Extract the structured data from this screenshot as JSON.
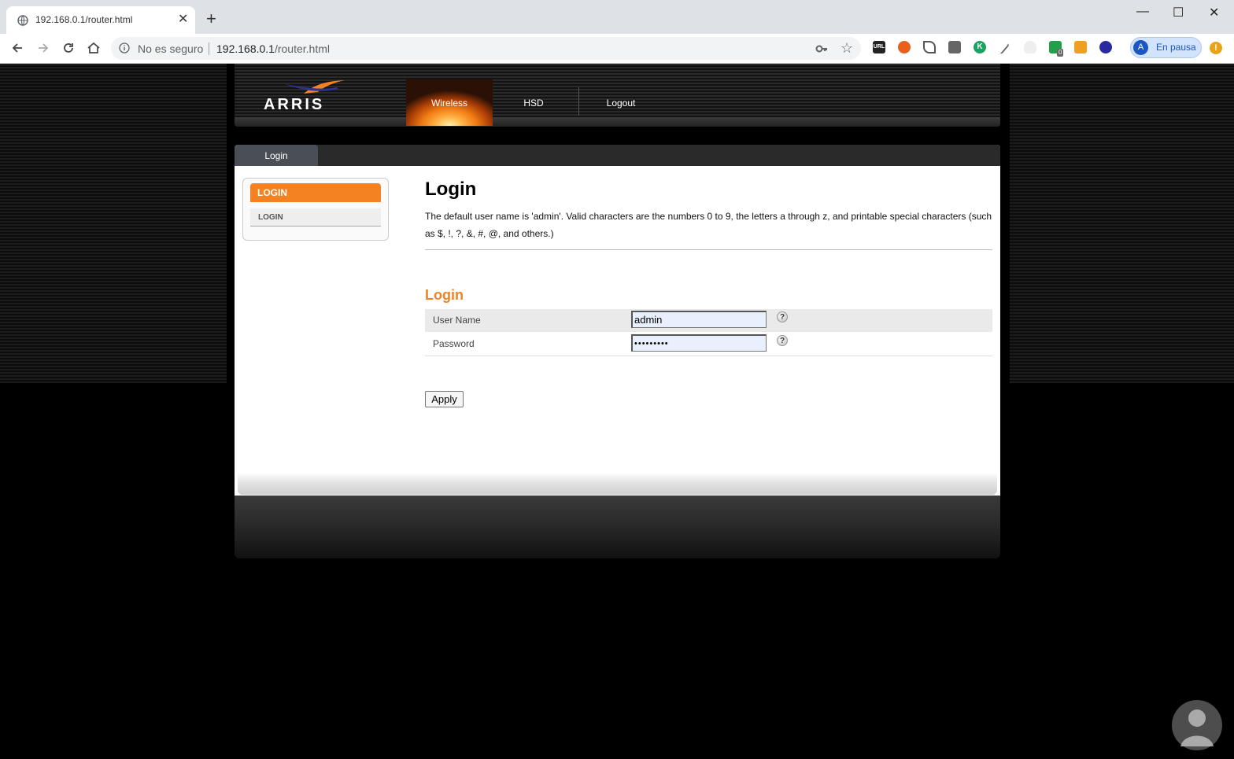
{
  "browser": {
    "tab_title": "192.168.0.1/router.html",
    "new_tab": "+",
    "window_controls": [
      "—",
      "☐",
      "✕"
    ],
    "security_label": "No es seguro",
    "url_host": "192.168.0.1",
    "url_path": "/router.html",
    "profile_initial": "A",
    "profile_status": "En pausa",
    "alert_icon": "!",
    "ext_badge": "0"
  },
  "router": {
    "brand": "ARRIS",
    "nav": [
      "Wireless",
      "HSD",
      "Logout"
    ],
    "active_tab": "Login",
    "sidebar": {
      "heading": "LOGIN",
      "items": [
        "LOGIN"
      ]
    },
    "page_title": "Login",
    "description": "The default user name is 'admin'. Valid characters are the numbers 0 to 9, the letters a through z, and printable special characters (such as $, !, ?, &, #, @, and others.)",
    "form": {
      "title": "Login",
      "username_label": "User Name",
      "username_value": "admin",
      "password_label": "Password",
      "password_value": "•••••••••",
      "help_glyph": "?",
      "apply_label": "Apply"
    }
  },
  "colors": {
    "accent_orange": "#f58220",
    "page_bg": "#000000",
    "input_bg": "#e8f0fe"
  }
}
